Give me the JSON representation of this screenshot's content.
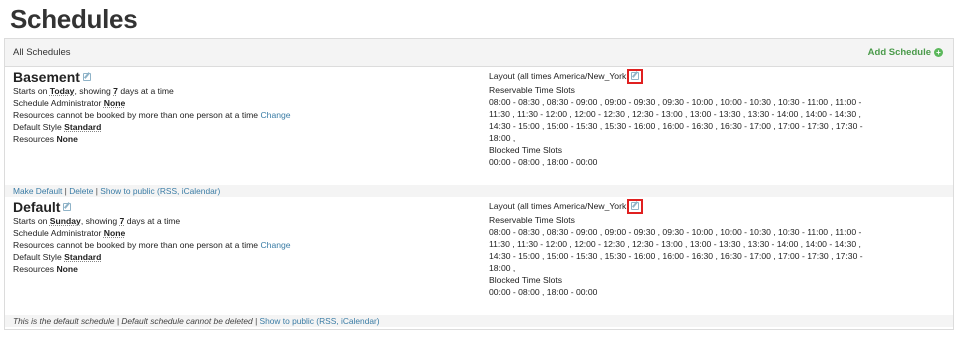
{
  "page_title": "Schedules",
  "panel": {
    "header": "All Schedules",
    "add_label": "Add Schedule"
  },
  "common": {
    "starts_on": "Starts on",
    "showing": ", showing",
    "days_at_a_time": "days at a time",
    "admin_label": "Schedule Administrator",
    "multi_book": "Resources cannot be booked by more than one person at a time",
    "change": "Change",
    "default_style_label": "Default Style",
    "resources_label": "Resources",
    "layout_label": "Layout (all times America/New_York",
    "reservable_label": "Reservable Time Slots",
    "blocked_label": "Blocked Time Slots"
  },
  "schedules": [
    {
      "name": "Basement",
      "start_day": "Today",
      "days": "7",
      "admin": "None",
      "style": "Standard",
      "resources": "None",
      "reservable_lines": [
        "08:00 - 08:30 , 08:30 - 09:00 , 09:00 - 09:30 , 09:30 - 10:00 , 10:00 - 10:30 , 10:30 - 11:00 , 11:00 -",
        "11:30 , 11:30 - 12:00 , 12:00 - 12:30 , 12:30 - 13:00 , 13:00 - 13:30 , 13:30 - 14:00 , 14:00 - 14:30 ,",
        "14:30 - 15:00 , 15:00 - 15:30 , 15:30 - 16:00 , 16:00 - 16:30 , 16:30 - 17:00 , 17:00 - 17:30 , 17:30 -",
        "18:00 ,"
      ],
      "blocked": "00:00 - 08:00 , 18:00 - 00:00",
      "actions": {
        "make_default": "Make Default",
        "delete": "Delete",
        "show_public": "Show to public (RSS, iCalendar)"
      }
    },
    {
      "name": "Default",
      "start_day": "Sunday",
      "days": "7",
      "admin": "None",
      "style": "Standard",
      "resources": "None",
      "reservable_lines": [
        "08:00 - 08:30 , 08:30 - 09:00 , 09:00 - 09:30 , 09:30 - 10:00 , 10:00 - 10:30 , 10:30 - 11:00 , 11:00 -",
        "11:30 , 11:30 - 12:00 , 12:00 - 12:30 , 12:30 - 13:00 , 13:00 - 13:30 , 13:30 - 14:00 , 14:00 - 14:30 ,",
        "14:30 - 15:00 , 15:00 - 15:30 , 15:30 - 16:00 , 16:00 - 16:30 , 16:30 - 17:00 , 17:00 - 17:30 , 17:30 -",
        "18:00 ,"
      ],
      "blocked": "00:00 - 08:00 , 18:00 - 00:00",
      "footer": {
        "is_default": "This is the default schedule",
        "cannot_delete": "Default schedule cannot be deleted",
        "show_public": "Show to public (RSS, iCalendar)"
      }
    }
  ],
  "colors": {
    "link": "#3a7ca5",
    "add": "#4a9a4a",
    "highlight": "#e02020"
  }
}
